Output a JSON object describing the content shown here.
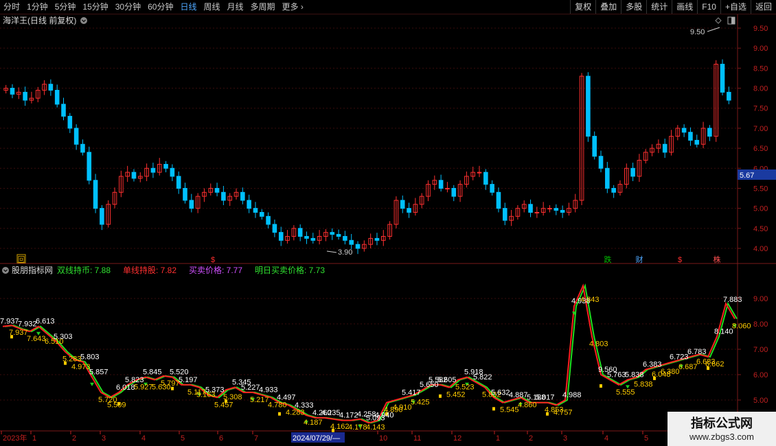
{
  "toolbar": {
    "periods": [
      "分时",
      "1分钟",
      "5分钟",
      "15分钟",
      "30分钟",
      "60分钟",
      "日线",
      "周线",
      "月线",
      "多周期",
      "更多"
    ],
    "active_period": "日线",
    "right_buttons": [
      "复权",
      "叠加",
      "多股",
      "统计",
      "画线",
      "F10",
      "+自选",
      "返回"
    ]
  },
  "main_chart": {
    "title": "海洋王(日线 前复权)",
    "axis_labels": [
      "9.50",
      "9.00",
      "8.50",
      "8.00",
      "7.50",
      "7.00",
      "6.50",
      "6.00",
      "5.50",
      "5.00",
      "4.50",
      "4.00"
    ],
    "price_tag": "5.67",
    "high_annotation": "9.50",
    "low_annotation": "3.90",
    "markers": [
      {
        "text": "回",
        "color": "#d0a000"
      },
      {
        "text": "$",
        "color": "#ff3030"
      },
      {
        "text": "跌",
        "color": "#00c000"
      },
      {
        "text": "财",
        "color": "#4fa8ff"
      },
      {
        "text": "$",
        "color": "#ff3030"
      },
      {
        "text": "株",
        "color": "#ff5050"
      }
    ]
  },
  "indicator": {
    "name": "股朋指标网",
    "legend": [
      {
        "label": "双线持币: 7.88",
        "color": "#30e030"
      },
      {
        "label": "单线持股: 7.82",
        "color": "#ff3030"
      },
      {
        "label": "买卖价格: 7.77",
        "color": "#d050ff"
      },
      {
        "label": "明日买卖价格: 7.73",
        "color": "#30e030"
      }
    ],
    "axis_labels": [
      "9.00",
      "8.00",
      "7.00",
      "6.00",
      "5.00"
    ],
    "value_labels": [
      {
        "t": "7.937",
        "c": "#ffffff"
      },
      {
        "t": "7.937",
        "c": "#ffcc00"
      },
      {
        "t": "7.932",
        "c": "#ffffff"
      },
      {
        "t": "7.643",
        "c": "#ffcc00"
      },
      {
        "t": "6.613",
        "c": "#ffffff"
      },
      {
        "t": "6.510",
        "c": "#ffcc00"
      },
      {
        "t": "5.303",
        "c": "#ffffff"
      },
      {
        "t": "5.283",
        "c": "#ffcc00"
      },
      {
        "t": "4.973",
        "c": "#ffcc00"
      },
      {
        "t": "5.803",
        "c": "#ffffff"
      },
      {
        "t": "5.857",
        "c": "#ffffff"
      },
      {
        "t": "5.720",
        "c": "#ffcc00"
      },
      {
        "t": "5.509",
        "c": "#ffcc00"
      },
      {
        "t": "6.018",
        "c": "#ffffff"
      },
      {
        "t": "5.823",
        "c": "#ffffff"
      },
      {
        "t": "5.927",
        "c": "#ffcc00"
      },
      {
        "t": "5.845",
        "c": "#ffffff"
      },
      {
        "t": "5.630",
        "c": "#ffcc00"
      },
      {
        "t": "5.797",
        "c": "#ffcc00"
      },
      {
        "t": "5.520",
        "c": "#ffffff"
      },
      {
        "t": "5.197",
        "c": "#ffffff"
      },
      {
        "t": "5.117",
        "c": "#ffcc00"
      },
      {
        "t": "5.163",
        "c": "#ffcc00"
      },
      {
        "t": "5.373",
        "c": "#ffffff"
      },
      {
        "t": "5.457",
        "c": "#ffcc00"
      },
      {
        "t": "5.308",
        "c": "#ffcc00"
      },
      {
        "t": "5.345",
        "c": "#ffffff"
      },
      {
        "t": "5.227",
        "c": "#ffffff"
      },
      {
        "t": "5.217",
        "c": "#ffcc00"
      },
      {
        "t": "4.933",
        "c": "#ffffff"
      },
      {
        "t": "4.780",
        "c": "#ffcc00"
      },
      {
        "t": "4.497",
        "c": "#ffffff"
      },
      {
        "t": "4.283",
        "c": "#ffcc00"
      },
      {
        "t": "4.333",
        "c": "#ffffff"
      },
      {
        "t": "4.187",
        "c": "#ffcc00"
      },
      {
        "t": "4.260",
        "c": "#ffffff"
      },
      {
        "t": "4.235",
        "c": "#ffffff"
      },
      {
        "t": "4.162",
        "c": "#ffcc00"
      },
      {
        "t": "4.172",
        "c": "#ffffff"
      },
      {
        "t": "4.178",
        "c": "#ffcc00"
      },
      {
        "t": "4.258",
        "c": "#ffffff"
      },
      {
        "t": "4.143",
        "c": "#ffcc00"
      },
      {
        "t": "5.093",
        "c": "#ffffff"
      },
      {
        "t": "4.940",
        "c": "#ffffff"
      },
      {
        "t": "4.890",
        "c": "#ffcc00"
      },
      {
        "t": "4.910",
        "c": "#ffcc00"
      },
      {
        "t": "5.417",
        "c": "#ffffff"
      },
      {
        "t": "5.425",
        "c": "#ffcc00"
      },
      {
        "t": "5.650",
        "c": "#ffffff"
      },
      {
        "t": "5.582",
        "c": "#ffffff"
      },
      {
        "t": "5.605",
        "c": "#ffffff"
      },
      {
        "t": "5.452",
        "c": "#ffcc00"
      },
      {
        "t": "5.523",
        "c": "#ffcc00"
      },
      {
        "t": "5.918",
        "c": "#ffffff"
      },
      {
        "t": "5.822",
        "c": "#ffffff"
      },
      {
        "t": "5.832",
        "c": "#ffcc00"
      },
      {
        "t": "5.632",
        "c": "#ffffff"
      },
      {
        "t": "5.545",
        "c": "#ffcc00"
      },
      {
        "t": "4.887",
        "c": "#ffffff"
      },
      {
        "t": "4.860",
        "c": "#ffcc00"
      },
      {
        "t": "5.188",
        "c": "#ffffff"
      },
      {
        "t": "5.017",
        "c": "#ffffff"
      },
      {
        "t": "4.853",
        "c": "#ffcc00"
      },
      {
        "t": "4.757",
        "c": "#ffcc00"
      },
      {
        "t": "4.988",
        "c": "#ffffff"
      },
      {
        "t": "4.938",
        "c": "#ffffff"
      },
      {
        "t": "4.843",
        "c": "#ffcc00"
      },
      {
        "t": "4.803",
        "c": "#ffcc00"
      },
      {
        "t": "9.560",
        "c": "#ffffff"
      },
      {
        "t": "5.763",
        "c": "#ffffff"
      },
      {
        "t": "5.555",
        "c": "#ffcc00"
      },
      {
        "t": "5.838",
        "c": "#ffffff"
      },
      {
        "t": "5.838",
        "c": "#ffcc00"
      },
      {
        "t": "6.383",
        "c": "#ffffff"
      },
      {
        "t": "6.048",
        "c": "#ffcc00"
      },
      {
        "t": "6.380",
        "c": "#ffcc00"
      },
      {
        "t": "6.723",
        "c": "#ffffff"
      },
      {
        "t": "6.687",
        "c": "#ffcc00"
      },
      {
        "t": "6.783",
        "c": "#ffffff"
      },
      {
        "t": "6.683",
        "c": "#ffcc00"
      },
      {
        "t": "6.662",
        "c": "#ffcc00"
      },
      {
        "t": "8.140",
        "c": "#ffffff"
      },
      {
        "t": "7.883",
        "c": "#ffffff"
      },
      {
        "t": "8.060",
        "c": "#ffcc00"
      }
    ]
  },
  "date_axis": {
    "labels": [
      "2023年",
      "1",
      "2",
      "3",
      "4",
      "5",
      "6",
      "7",
      "2024/07/29/—",
      "10",
      "11",
      "12",
      "1",
      "2",
      "3",
      "4",
      "5"
    ],
    "highlight": "2024/07/29/—"
  },
  "watermark": {
    "line1": "指标公式网",
    "line2": "www.zbgs3.com"
  },
  "colors": {
    "up": "#ff3030",
    "down": "#00c0ff",
    "grid": "#5a1010",
    "ind_red": "#ff2020",
    "ind_green": "#20e020"
  },
  "chart_data": [
    {
      "type": "candlestick",
      "title": "海洋王(日线 前复权)",
      "ylim": [
        3.75,
        9.75
      ],
      "high": 9.5,
      "low": 3.9,
      "last": 5.67,
      "close": [
        8.0,
        7.85,
        7.9,
        7.7,
        7.75,
        7.95,
        8.1,
        7.95,
        7.6,
        7.3,
        7.0,
        6.6,
        6.4,
        5.7,
        5.0,
        4.6,
        5.1,
        5.4,
        5.8,
        5.9,
        5.75,
        5.8,
        6.0,
        5.9,
        6.1,
        6.0,
        5.8,
        5.5,
        5.2,
        5.0,
        5.3,
        5.4,
        5.5,
        5.4,
        5.2,
        5.3,
        5.4,
        5.2,
        5.0,
        4.9,
        4.8,
        4.6,
        4.4,
        4.2,
        4.3,
        4.5,
        4.3,
        4.25,
        4.2,
        4.3,
        4.4,
        4.35,
        4.3,
        4.2,
        4.1,
        4.0,
        4.1,
        4.25,
        4.2,
        4.3,
        4.6,
        5.2,
        5.0,
        4.9,
        5.1,
        5.3,
        5.6,
        5.7,
        5.5,
        5.5,
        5.3,
        5.6,
        5.8,
        5.9,
        5.9,
        5.6,
        5.4,
        5.0,
        4.7,
        4.8,
        5.0,
        5.1,
        4.9,
        4.9,
        5.0,
        5.0,
        4.95,
        4.9,
        5.0,
        5.2,
        8.3,
        6.8,
        6.3,
        6.0,
        5.5,
        5.4,
        5.6,
        6.0,
        5.8,
        6.2,
        6.4,
        6.5,
        6.6,
        6.4,
        6.8,
        7.0,
        6.9,
        6.7,
        6.6,
        7.0,
        6.8,
        8.6,
        7.9,
        7.7
      ]
    },
    {
      "type": "line",
      "title": "股朋指标网",
      "ylim": [
        4.0,
        10.0
      ],
      "series": [
        {
          "name": "双线持币",
          "values": [
            7.9,
            7.94,
            7.8,
            7.7,
            7.9,
            7.6,
            7.3,
            6.9,
            6.6,
            6.5,
            5.9,
            5.3,
            5.1,
            5.3,
            5.6,
            5.8,
            5.9,
            5.8,
            5.95,
            5.9,
            5.6,
            5.6,
            5.5,
            5.2,
            5.1,
            5.4,
            5.5,
            5.3,
            5.3,
            5.2,
            5.1,
            4.9,
            4.8,
            4.6,
            4.4,
            4.3,
            4.3,
            4.25,
            4.2,
            4.2,
            4.25,
            4.1,
            4.2,
            4.9,
            5.0,
            5.1,
            5.2,
            5.4,
            5.6,
            5.6,
            5.5,
            5.8,
            5.9,
            5.7,
            5.5,
            5.1,
            4.9,
            5.0,
            5.1,
            4.9,
            4.9,
            4.9,
            4.8,
            5.0,
            8.7,
            9.5,
            7.5,
            6.0,
            5.8,
            5.6,
            5.8,
            5.9,
            6.2,
            6.3,
            6.4,
            6.5,
            6.6,
            6.7,
            6.8,
            6.7,
            7.5,
            8.8,
            8.2
          ]
        },
        {
          "name": "单线持股",
          "values": [
            7.9,
            7.94,
            7.8,
            7.7,
            7.9,
            7.6,
            7.3,
            6.9,
            6.6,
            6.5,
            5.9,
            5.3,
            5.1,
            5.3,
            5.6,
            5.8,
            5.9,
            5.8,
            5.95,
            5.9,
            5.6,
            5.6,
            5.5,
            5.2,
            5.1,
            5.4,
            5.5,
            5.3,
            5.3,
            5.2,
            5.1,
            4.9,
            4.8,
            4.6,
            4.4,
            4.3,
            4.3,
            4.25,
            4.2,
            4.2,
            4.25,
            4.1,
            4.2,
            4.9,
            5.0,
            5.1,
            5.2,
            5.4,
            5.6,
            5.6,
            5.5,
            5.8,
            5.9,
            5.7,
            5.5,
            5.1,
            4.9,
            5.0,
            5.1,
            4.9,
            4.9,
            4.9,
            4.8,
            5.0,
            8.7,
            9.5,
            7.5,
            6.0,
            5.8,
            5.6,
            5.8,
            5.9,
            6.2,
            6.3,
            6.4,
            6.5,
            6.6,
            6.7,
            6.8,
            6.7,
            7.5,
            8.8,
            8.2
          ]
        }
      ],
      "last_values": {
        "双线持币": 7.88,
        "单线持股": 7.82,
        "买卖价格": 7.77,
        "明日买卖价格": 7.73
      }
    }
  ]
}
